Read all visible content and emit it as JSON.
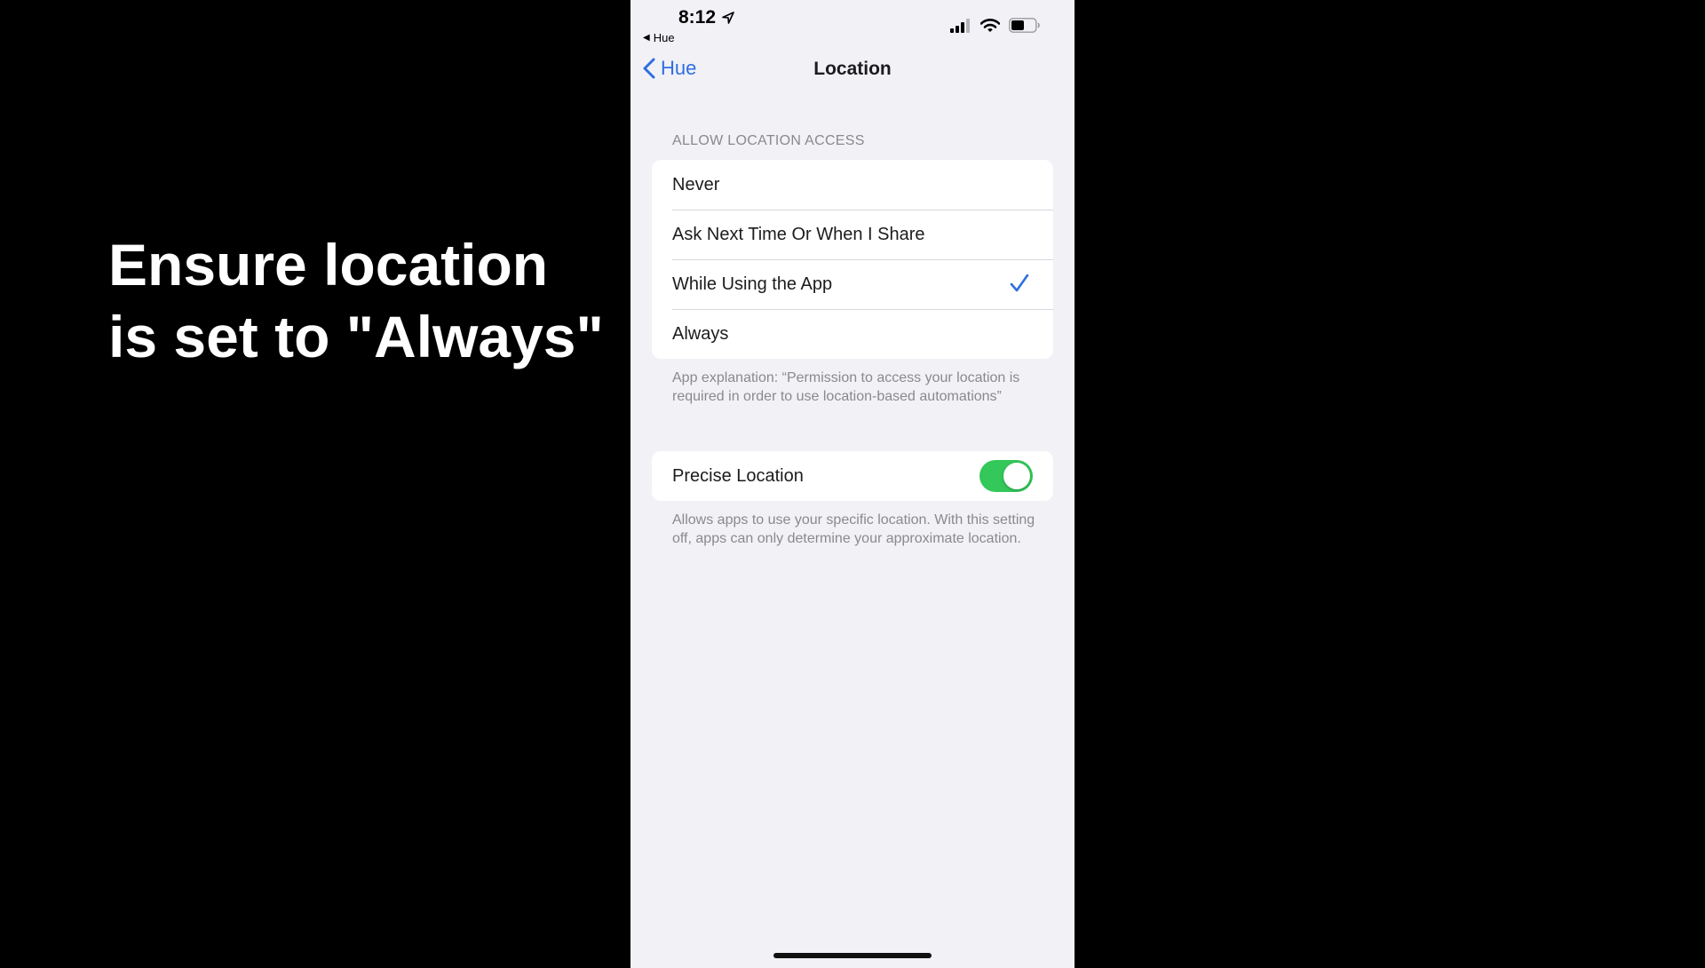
{
  "caption": {
    "line1": "Ensure location",
    "line2": "is set to \"Always\""
  },
  "status_bar": {
    "time": "8:12",
    "back_app": "Hue",
    "icons": [
      "location-arrow-icon",
      "cellular-signal-icon",
      "wifi-icon",
      "battery-icon"
    ]
  },
  "nav": {
    "back_label": "Hue",
    "title": "Location"
  },
  "allow_access": {
    "header": "ALLOW LOCATION ACCESS",
    "options": [
      {
        "label": "Never",
        "selected": false
      },
      {
        "label": "Ask Next Time Or When I Share",
        "selected": false
      },
      {
        "label": "While Using the App",
        "selected": true
      },
      {
        "label": "Always",
        "selected": false
      }
    ],
    "explanation": "App explanation: “Permission to access your location is required in order to use location-based automations”"
  },
  "precise_location": {
    "label": "Precise Location",
    "enabled": true,
    "footnote": "Allows apps to use your specific location. With this setting off, apps can only determine your approximate location."
  },
  "colors": {
    "accent": "#2f6fe0",
    "toggle_on": "#34c759",
    "background": "#f1f1f6",
    "outer_background": "#000000"
  }
}
